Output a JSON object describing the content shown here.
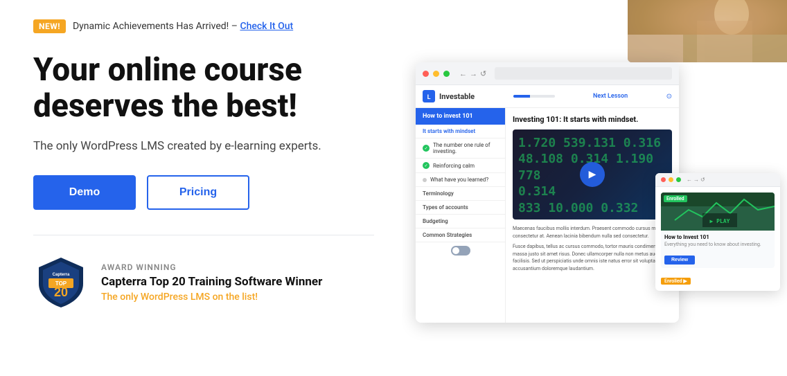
{
  "announcement": {
    "badge": "NEW!",
    "text": "Dynamic Achievements Has Arrived! –",
    "link_text": "Check It Out"
  },
  "hero": {
    "heading_line1": "Your online course",
    "heading_line2": "deserves the best!",
    "subtitle": "The only WordPress LMS created by e-learning experts.",
    "btn_demo": "Demo",
    "btn_pricing": "Pricing"
  },
  "award": {
    "label": "AWARD WINNING",
    "title": "Capterra Top 20 Training Software Winner",
    "subtitle": "The only WordPress LMS on the list!"
  },
  "lms_ui": {
    "logo": "Investable",
    "next_lesson": "Next Lesson",
    "course_title": "How to invest 101",
    "lesson_title": "Investing 101: It starts with mindset.",
    "sidebar_items": [
      {
        "label": "It starts with mindset",
        "type": "active"
      },
      {
        "label": "The number one rule of investing.",
        "type": "checked"
      },
      {
        "label": "Reinforcing calm",
        "type": "checked"
      },
      {
        "label": "What have you learned?",
        "type": "bullet"
      },
      {
        "label": "Terminology",
        "type": "section"
      },
      {
        "label": "Types of accounts",
        "type": "section"
      },
      {
        "label": "Budgeting",
        "type": "section"
      },
      {
        "label": "Common Strategies",
        "type": "section"
      }
    ],
    "body_text": "Maecenas faucibus mollis interdum. Praesent commodo cursus magna consectetur at. Aenean lacinia bibendum nulla sed consectetur.",
    "body_text2": "Fusce dapibus, tellus ac cursus commodo, tortor mauris condiment massa justo sit amet risus. Donec ullamcorper nulla non metus auctor facilisis. Sed ut perspiciatis unde omnis iste natus error sit voluptatem accusantium doloremque laudantium."
  },
  "course_card": {
    "badge": "Enrolled",
    "title": "How to Invest 101",
    "subtitle": "Everything you need to know about investing.",
    "btn_label": "Review",
    "enrolled_label": "Enrolled ▶"
  },
  "colors": {
    "primary": "#2563eb",
    "orange": "#f5a623",
    "green": "#22c55e"
  }
}
